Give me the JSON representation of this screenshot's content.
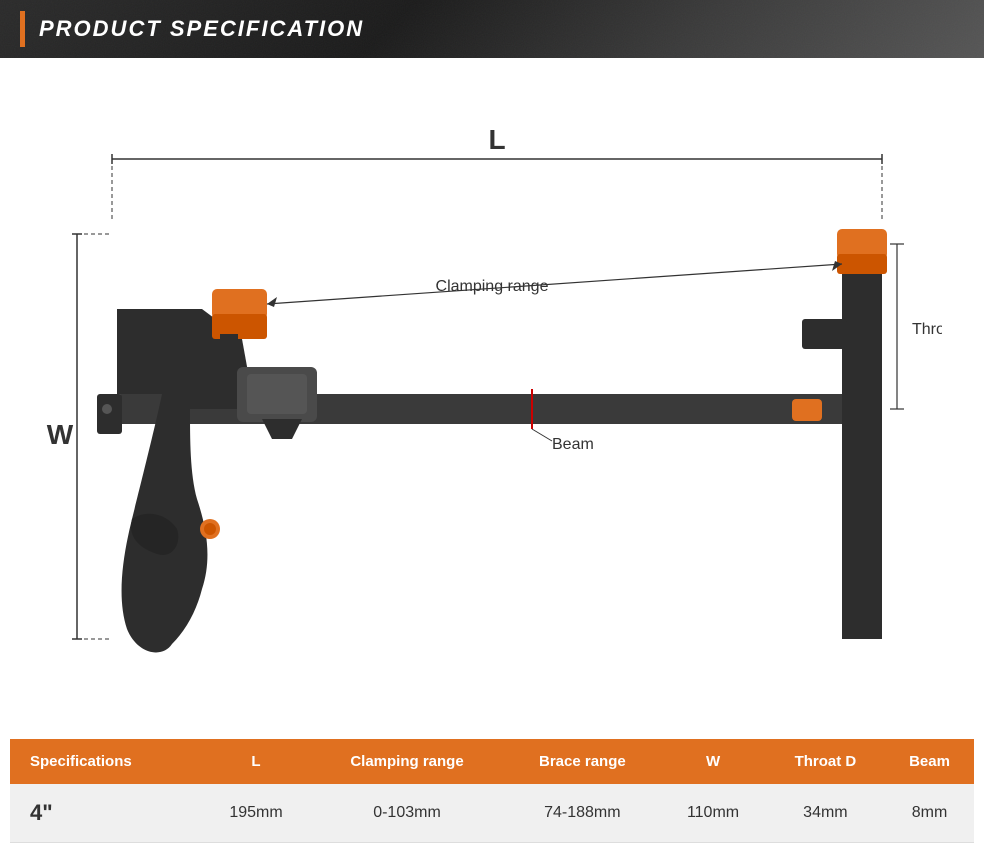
{
  "header": {
    "title": "PRODUCT SPECIFICATION",
    "accent_color": "#e07020"
  },
  "diagram": {
    "labels": {
      "L": "L",
      "W": "W",
      "clamping_range": "Clamping range",
      "throat_d": "Throat D",
      "beam": "Beam"
    }
  },
  "table": {
    "headers": [
      "Specifications",
      "L",
      "Clamping range",
      "Brace range",
      "W",
      "Throat D",
      "Beam"
    ],
    "rows": [
      {
        "spec": "4\"",
        "L": "195mm",
        "clamping_range": "0-103mm",
        "brace_range": "74-188mm",
        "W": "110mm",
        "throat_d": "34mm",
        "beam": "8mm"
      }
    ]
  }
}
